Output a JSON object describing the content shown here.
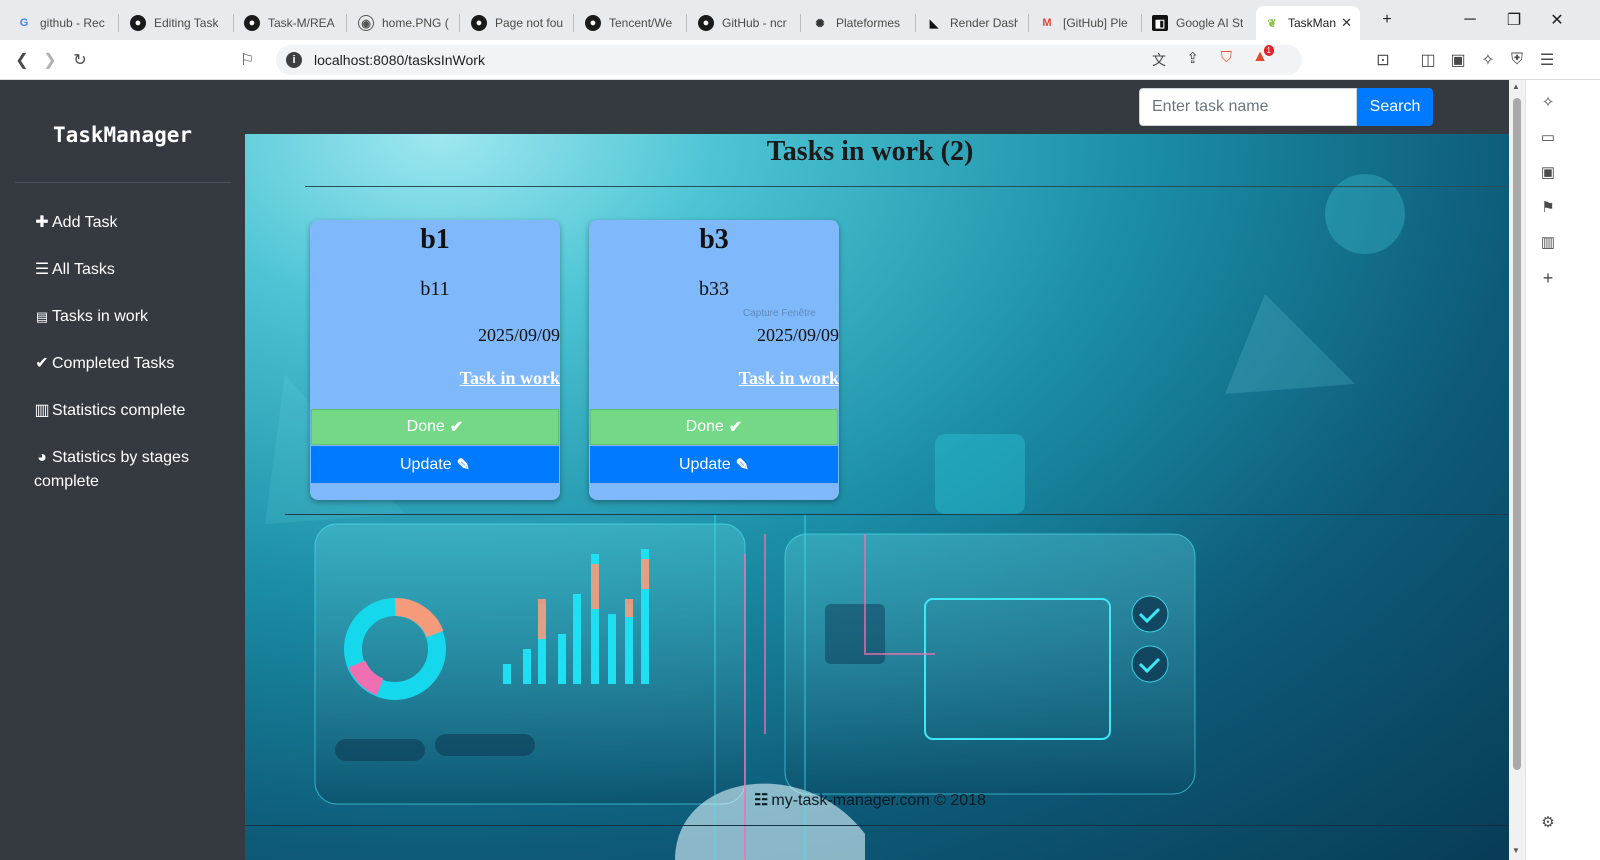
{
  "browser": {
    "tabs": [
      {
        "label": "github - Rec",
        "icon": "google-icon"
      },
      {
        "label": "Editing Task",
        "icon": "github-icon"
      },
      {
        "label": "Task-M/REA",
        "icon": "github-icon"
      },
      {
        "label": "home.PNG (",
        "icon": "globe-icon"
      },
      {
        "label": "Page not fou",
        "icon": "github-icon"
      },
      {
        "label": "Tencent/We",
        "icon": "github-icon"
      },
      {
        "label": "GitHub - ncr",
        "icon": "github-icon"
      },
      {
        "label": "Plateformes",
        "icon": "openai-icon"
      },
      {
        "label": "Render Dash",
        "icon": "render-icon"
      },
      {
        "label": "[GitHub] Ple",
        "icon": "gmail-icon"
      },
      {
        "label": "Google AI St",
        "icon": "ai-studio-icon"
      },
      {
        "label": "TaskMan",
        "icon": "leaf-icon",
        "active": true
      }
    ],
    "new_tab": "+",
    "url": "localhost:8080/tasksInWork",
    "shields_badge": "1"
  },
  "app": {
    "brand": "TaskManager",
    "nav": [
      {
        "icon": "plus-icon",
        "glyph": "✚",
        "label": "Add Task"
      },
      {
        "icon": "list-icon",
        "glyph": "☰",
        "label": "All Tasks"
      },
      {
        "icon": "clipboard-icon",
        "glyph": "📋",
        "label": "Tasks in work"
      },
      {
        "icon": "clipboard-check-icon",
        "glyph": "✔",
        "label": "Completed Tasks"
      },
      {
        "icon": "bar-chart-icon",
        "glyph": "▥",
        "label": "Statistics complete"
      },
      {
        "icon": "pie-chart-icon",
        "glyph": "◕",
        "label": "Statistics by stages complete"
      }
    ],
    "search": {
      "placeholder": "Enter task name",
      "button": "Search"
    },
    "page_title": "Tasks in work (2)",
    "cards": [
      {
        "title": "b1",
        "description": "b11",
        "date": "2025/09/09",
        "status": "Task in work",
        "done_label": "Done",
        "update_label": "Update"
      },
      {
        "title": "b3",
        "description": "b33",
        "date": "2025/09/09",
        "status": "Task in work",
        "done_label": "Done",
        "update_label": "Update"
      }
    ],
    "overlay_text": "Capture Fenêtre",
    "footer": "my-task-manager.com © 2018"
  },
  "colors": {
    "sidebar": "#343a40",
    "primary": "#007bff",
    "done": "#74d886",
    "card": "#7fb9fb"
  }
}
